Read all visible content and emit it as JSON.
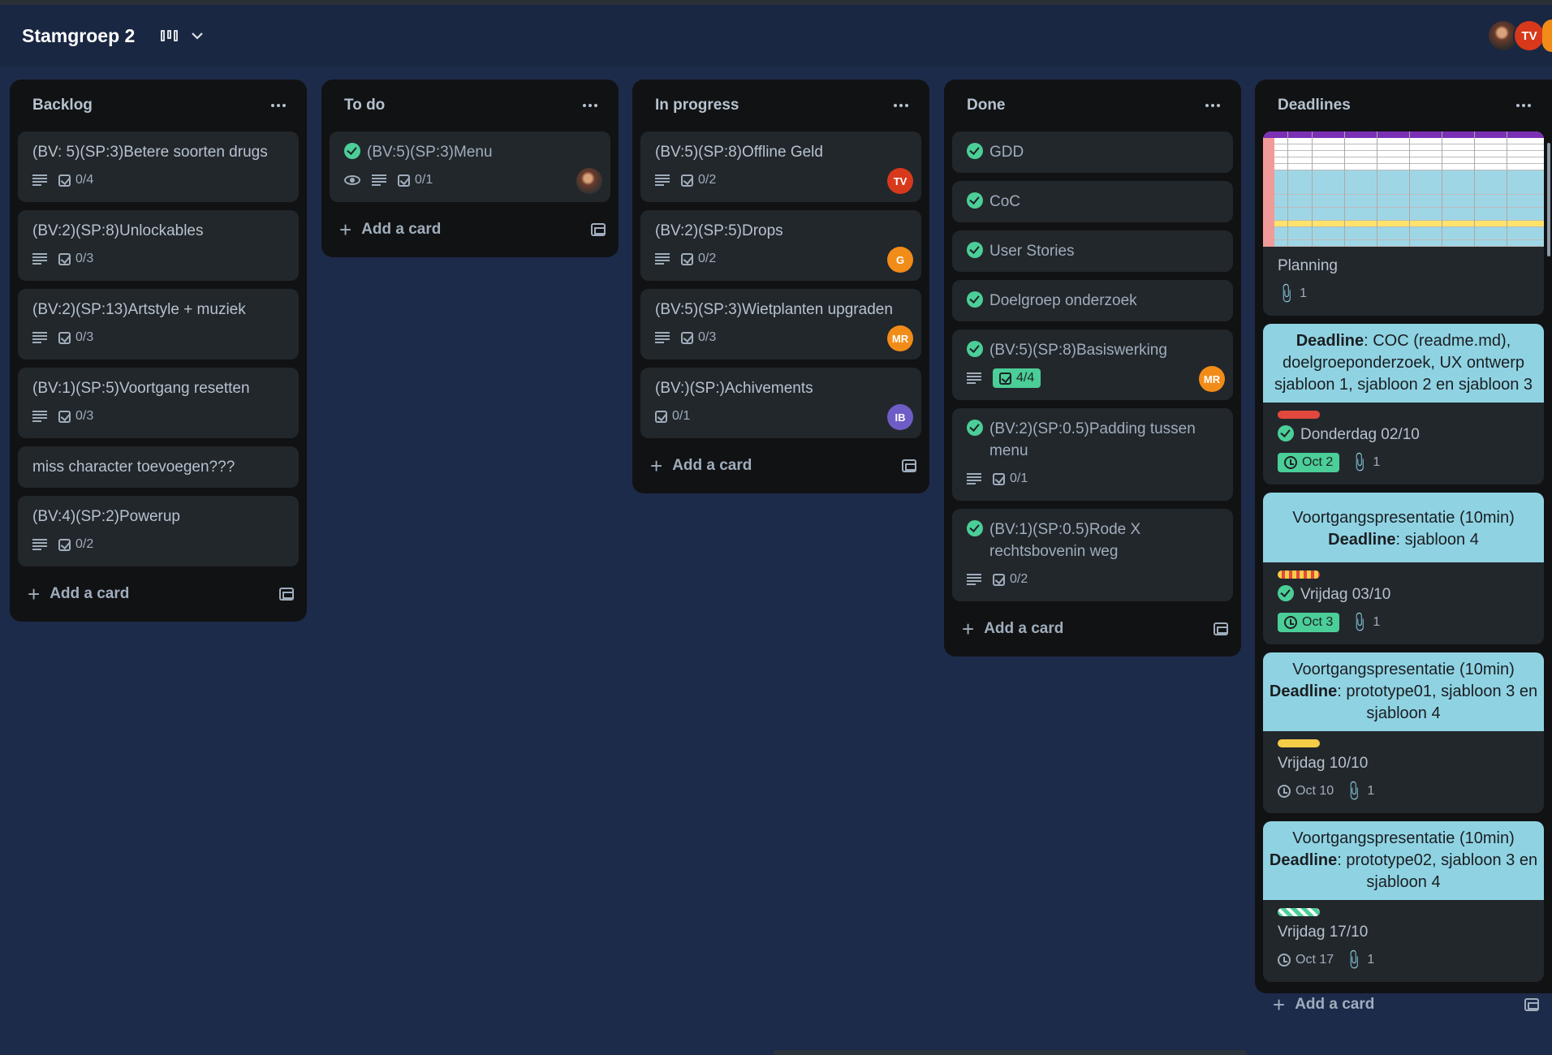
{
  "header": {
    "board_title": "Stamgroep 2",
    "view_icon": "board-view-icon",
    "avatar_initials": "TV"
  },
  "colors": {
    "background": "#1d2b4a",
    "list_bg": "#111213",
    "card_bg": "#22272b",
    "complete_green": "#4bce97",
    "cover_blue": "#8fd3e3"
  },
  "add_card_label": "Add a card",
  "lists": [
    {
      "title": "Backlog",
      "cards": [
        {
          "title": "(BV: 5)(SP:3)Betere soorten drugs",
          "checklist": "0/4"
        },
        {
          "title": "(BV:2)(SP:8)Unlockables",
          "checklist": "0/3"
        },
        {
          "title": "(BV:2)(SP:13)Artstyle + muziek",
          "checklist": "0/3"
        },
        {
          "title": "(BV:1)(SP:5)Voortgang resetten",
          "checklist": "0/3"
        },
        {
          "title": "miss character toevoegen???"
        },
        {
          "title": "(BV:4)(SP:2)Powerup",
          "checklist": "0/2"
        }
      ]
    },
    {
      "title": "To do",
      "cards": [
        {
          "title": "(BV:5)(SP:3)Menu",
          "checklist": "0/1"
        }
      ]
    },
    {
      "title": "In progress",
      "cards": [
        {
          "title": "(BV:5)(SP:8)Offline Geld",
          "checklist": "0/2",
          "member": "TV"
        },
        {
          "title": "(BV:2)(SP:5)Drops",
          "checklist": "0/2",
          "member": "G"
        },
        {
          "title": "(BV:5)(SP:3)Wietplanten upgraden",
          "checklist": "0/3",
          "member": "MR"
        },
        {
          "title": "(BV:)(SP:)Achivements",
          "checklist": "0/1",
          "member": "IB"
        }
      ]
    },
    {
      "title": "Done",
      "cards": [
        {
          "title": "GDD"
        },
        {
          "title": "CoC"
        },
        {
          "title": "User Stories"
        },
        {
          "title": "Doelgroep onderzoek"
        },
        {
          "title": "(BV:5)(SP:8)Basiswerking",
          "checklist": "4/4",
          "member": "MR"
        },
        {
          "title": "(BV:2)(SP:0.5)Padding tussen menu",
          "checklist": "0/1"
        },
        {
          "title": "(BV:1)(SP:0.5)Rode X rechtsbovenin weg",
          "checklist": "0/2"
        }
      ]
    },
    {
      "title": "Deadlines",
      "cards": [
        {
          "title": "Planning",
          "attachments": "1"
        },
        {
          "cover_bold": "Deadline",
          "cover_rest": ": COC (readme.md), doelgroeponderzoek, UX ontwerp sjabloon 1, sjabloon 2 en sjabloon 3",
          "title": "Donderdag 02/10",
          "due": "Oct 2",
          "attachments": "1"
        },
        {
          "cover_pre": "Voortgangspresentatie (10min)",
          "cover_bold": "Deadline",
          "cover_rest": ": sjabloon 4",
          "title": "Vrijdag 03/10",
          "due": "Oct 3",
          "attachments": "1"
        },
        {
          "cover_pre": "Voortgangspresentatie (10min)",
          "cover_bold": "Deadline",
          "cover_rest": ": prototype01, sjabloon 3 en sjabloon 4",
          "title": "Vrijdag 10/10",
          "due": "Oct 10",
          "attachments": "1"
        },
        {
          "cover_pre": "Voortgangspresentatie (10min)",
          "cover_bold": "Deadline",
          "cover_rest": ": prototype02, sjabloon 3 en sjabloon 4",
          "title": "Vrijdag 17/10",
          "due": "Oct 17",
          "attachments": "1"
        }
      ]
    }
  ]
}
